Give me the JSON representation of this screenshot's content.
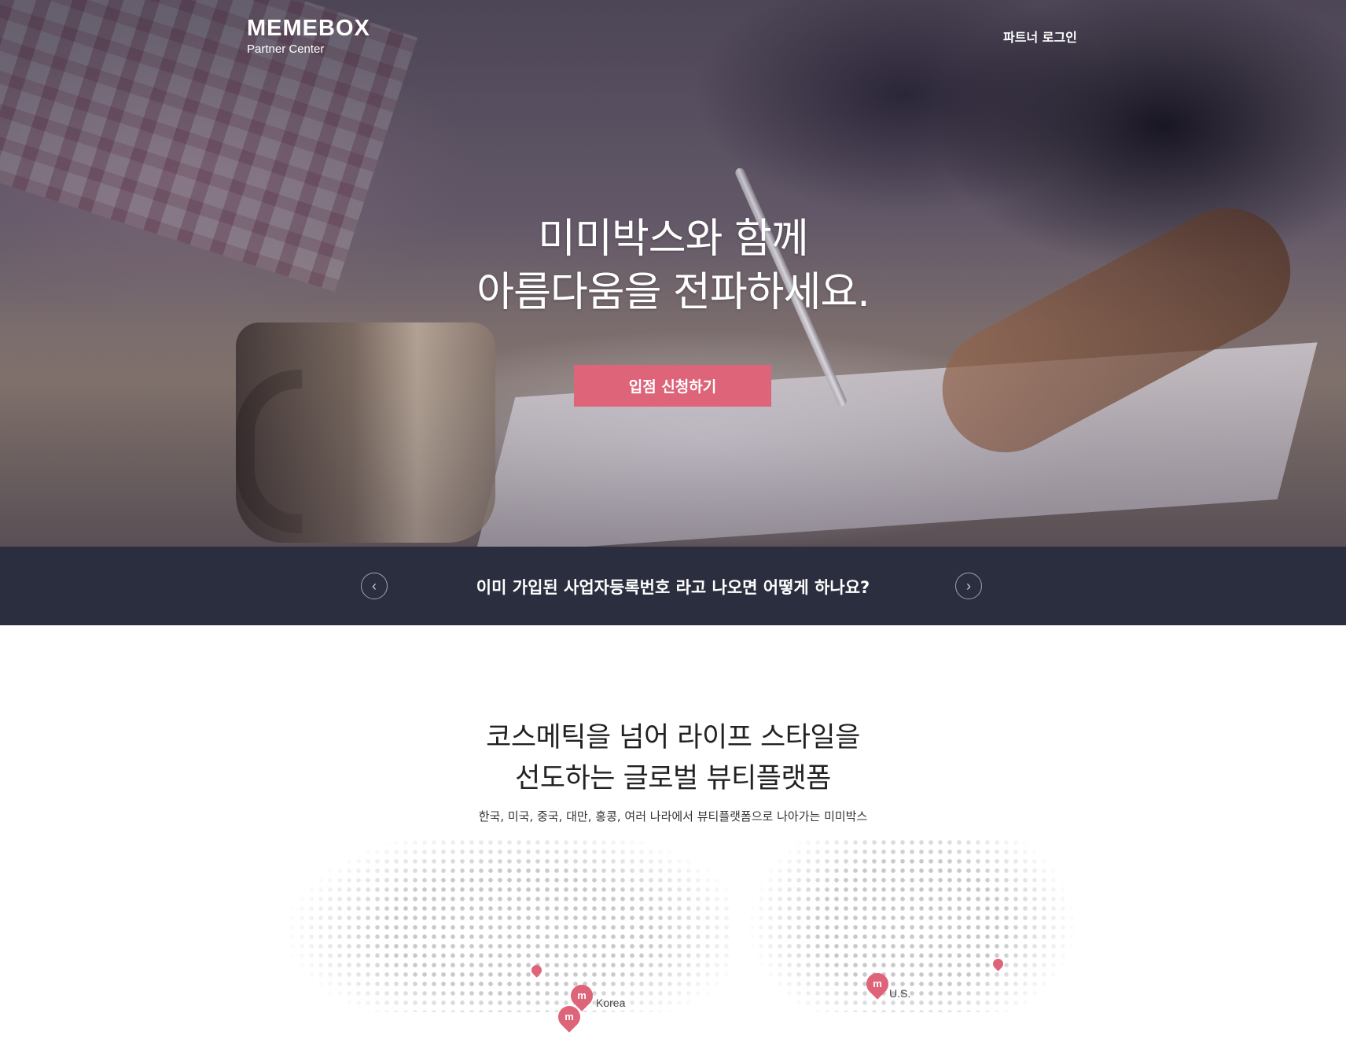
{
  "header": {
    "logo_main": "MEMEBOX",
    "logo_sub": "Partner Center",
    "login_label": "파트너 로그인"
  },
  "hero": {
    "title_line1": "미미박스와 함께",
    "title_line2": "아름다움을 전파하세요.",
    "cta_label": "입점 신청하기"
  },
  "notice": {
    "text": "이미 가입된 사업자등록번호 라고 나오면 어떻게 하나요?",
    "prev_icon": "chevron-left-icon",
    "next_icon": "chevron-right-icon"
  },
  "platform": {
    "title_line1": "코스메틱을 넘어 라이프 스타일을",
    "title_line2": "선도하는 글로벌 뷰티플랫폼",
    "subtitle": "한국, 미국, 중국, 대만, 홍콩, 여러 나라에서 뷰티플랫폼으로 나아가는 미미박스",
    "map": {
      "pin_glyph": "m",
      "locations": [
        {
          "label": "Korea"
        },
        {
          "label": "U.S."
        }
      ]
    }
  },
  "colors": {
    "accent": "#de6479",
    "notice_bar": "#2b2e3e",
    "map_dots": "#c9c9cc"
  }
}
